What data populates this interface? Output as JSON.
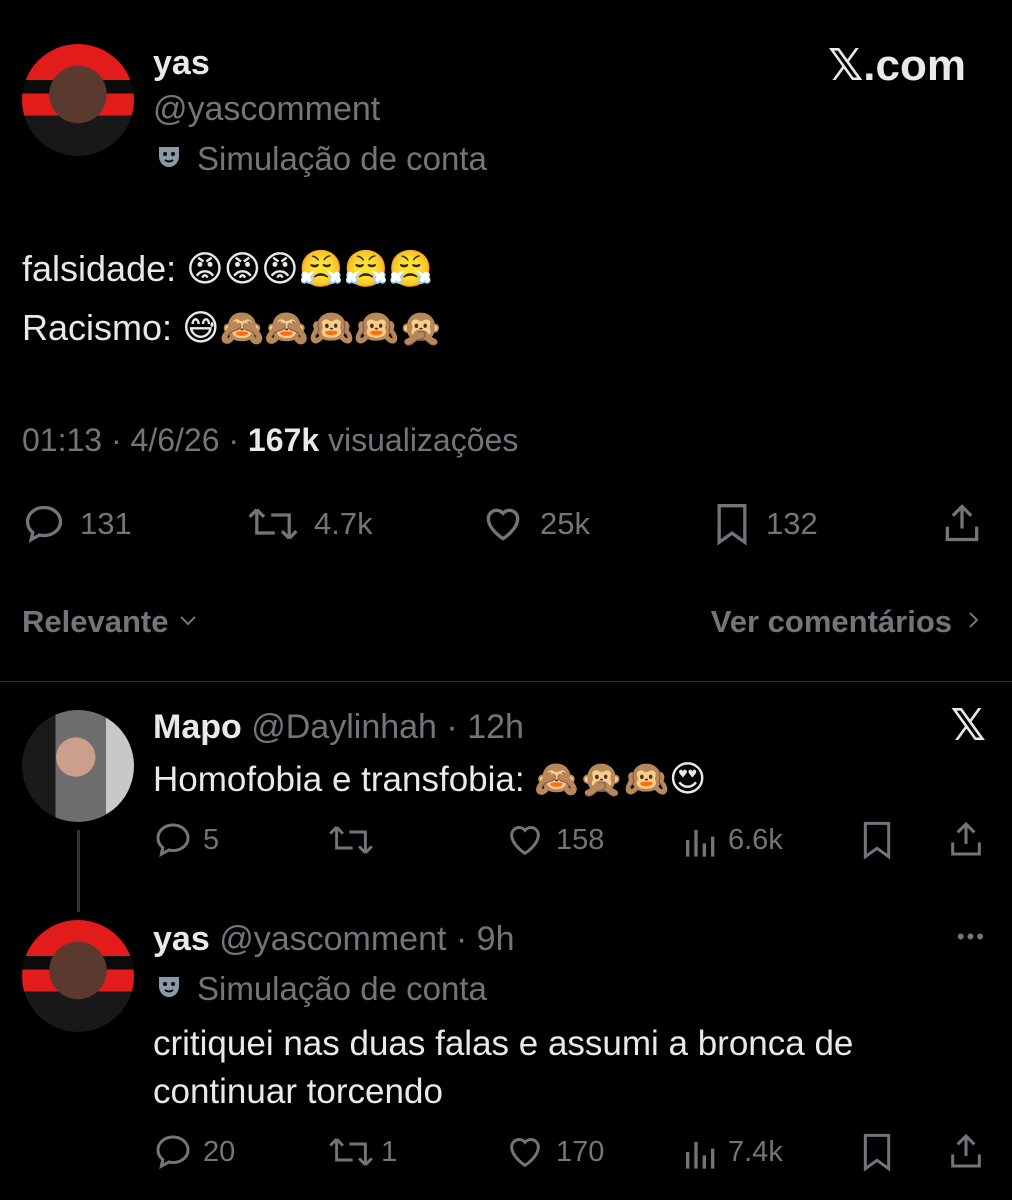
{
  "main_post": {
    "author_name": "yas",
    "handle": "@yascomment",
    "account_label": "Simulação de conta",
    "site_logo": "𝕏.com",
    "line1_text": "falsidade:",
    "line1_emojis": "😡😡😡😤😤😤",
    "line2_text": "Racismo:",
    "line2_emojis": "😅🙈🙈🙉🙉🙊",
    "time": "01:13",
    "date": "4/6/26",
    "views": "167k",
    "views_label": "visualizações",
    "replies": "131",
    "reposts": "4.7k",
    "likes": "25k",
    "bookmarks": "132"
  },
  "sort": {
    "label": "Relevante",
    "see_comments": "Ver comentários"
  },
  "reply1": {
    "author_name": "Mapo",
    "handle": "@Daylinhah",
    "time": "12h",
    "text": "Homofobia e transfobia:",
    "emojis": "🙈🙊🙉😍",
    "replies": "5",
    "likes": "158",
    "views": "6.6k",
    "site_logo": "𝕏"
  },
  "reply2": {
    "author_name": "yas",
    "handle": "@yascomment",
    "time": "9h",
    "account_label": "Simulação de conta",
    "text_line1": "critiquei nas duas falas e assumi a bronca de",
    "text_line2": "continuar torcendo",
    "replies": "20",
    "reposts": "1",
    "likes": "170",
    "views": "7.4k",
    "more": "•••"
  },
  "icons": {
    "reply": "reply-icon",
    "repost": "repost-icon",
    "like": "heart-icon",
    "bookmark": "bookmark-icon",
    "share": "share-icon",
    "views": "views-icon",
    "parody": "mask-icon"
  },
  "colors": {
    "background": "#000000",
    "text": "#e7e9ea",
    "muted": "#71767b",
    "divider": "#2f3336"
  }
}
